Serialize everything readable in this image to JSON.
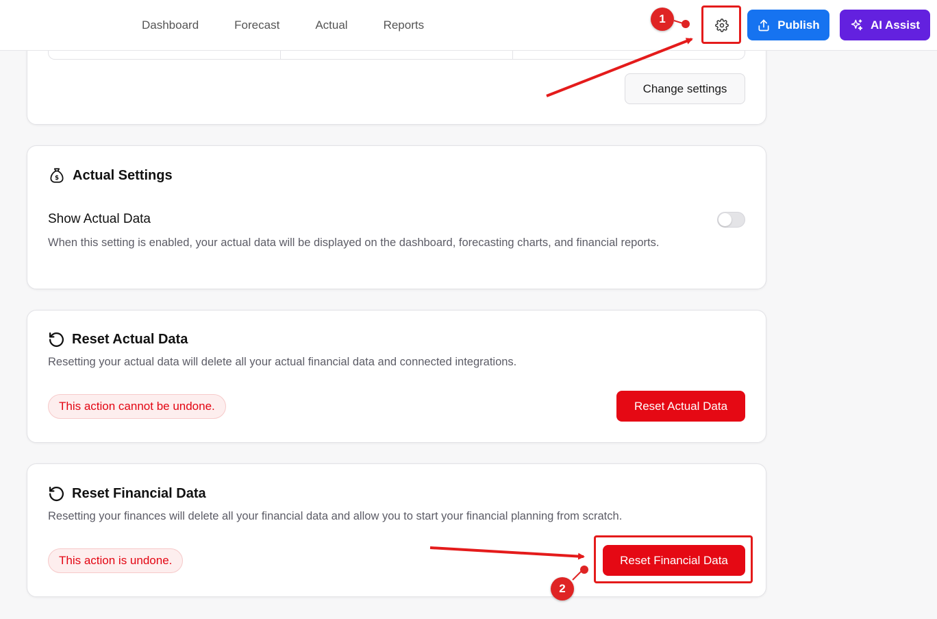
{
  "nav": {
    "items": [
      {
        "label": "Dashboard"
      },
      {
        "label": "Forecast"
      },
      {
        "label": "Actual"
      },
      {
        "label": "Reports"
      }
    ]
  },
  "header": {
    "settings_icon": "gear-icon",
    "publish_label": "Publish",
    "ai_assist_label": "AI Assist"
  },
  "top_card": {
    "change_settings_label": "Change settings"
  },
  "actual_settings": {
    "title": "Actual Settings",
    "icon": "money-bag-icon",
    "show_actual": {
      "label": "Show Actual Data",
      "description": "When this setting is enabled, your actual data will be displayed on the dashboard, forecasting charts, and financial reports.",
      "enabled": false
    }
  },
  "reset_actual": {
    "title": "Reset Actual Data",
    "icon": "reset-icon",
    "description": "Resetting your actual data will delete all your actual financial data and connected integrations.",
    "warning": "This action cannot be undone.",
    "button_label": "Reset Actual Data"
  },
  "reset_financial": {
    "title": "Reset Financial Data",
    "icon": "reset-icon",
    "description": "Resetting your finances will delete all your financial data and allow you to start your financial planning from scratch.",
    "warning": "This action is undone.",
    "button_label": "Reset Financial Data"
  },
  "annotations": {
    "step1": "1",
    "step2": "2",
    "color": "#df2424"
  },
  "colors": {
    "publish": "#1673f0",
    "ai_assist": "#6321df",
    "danger": "#e50914"
  }
}
